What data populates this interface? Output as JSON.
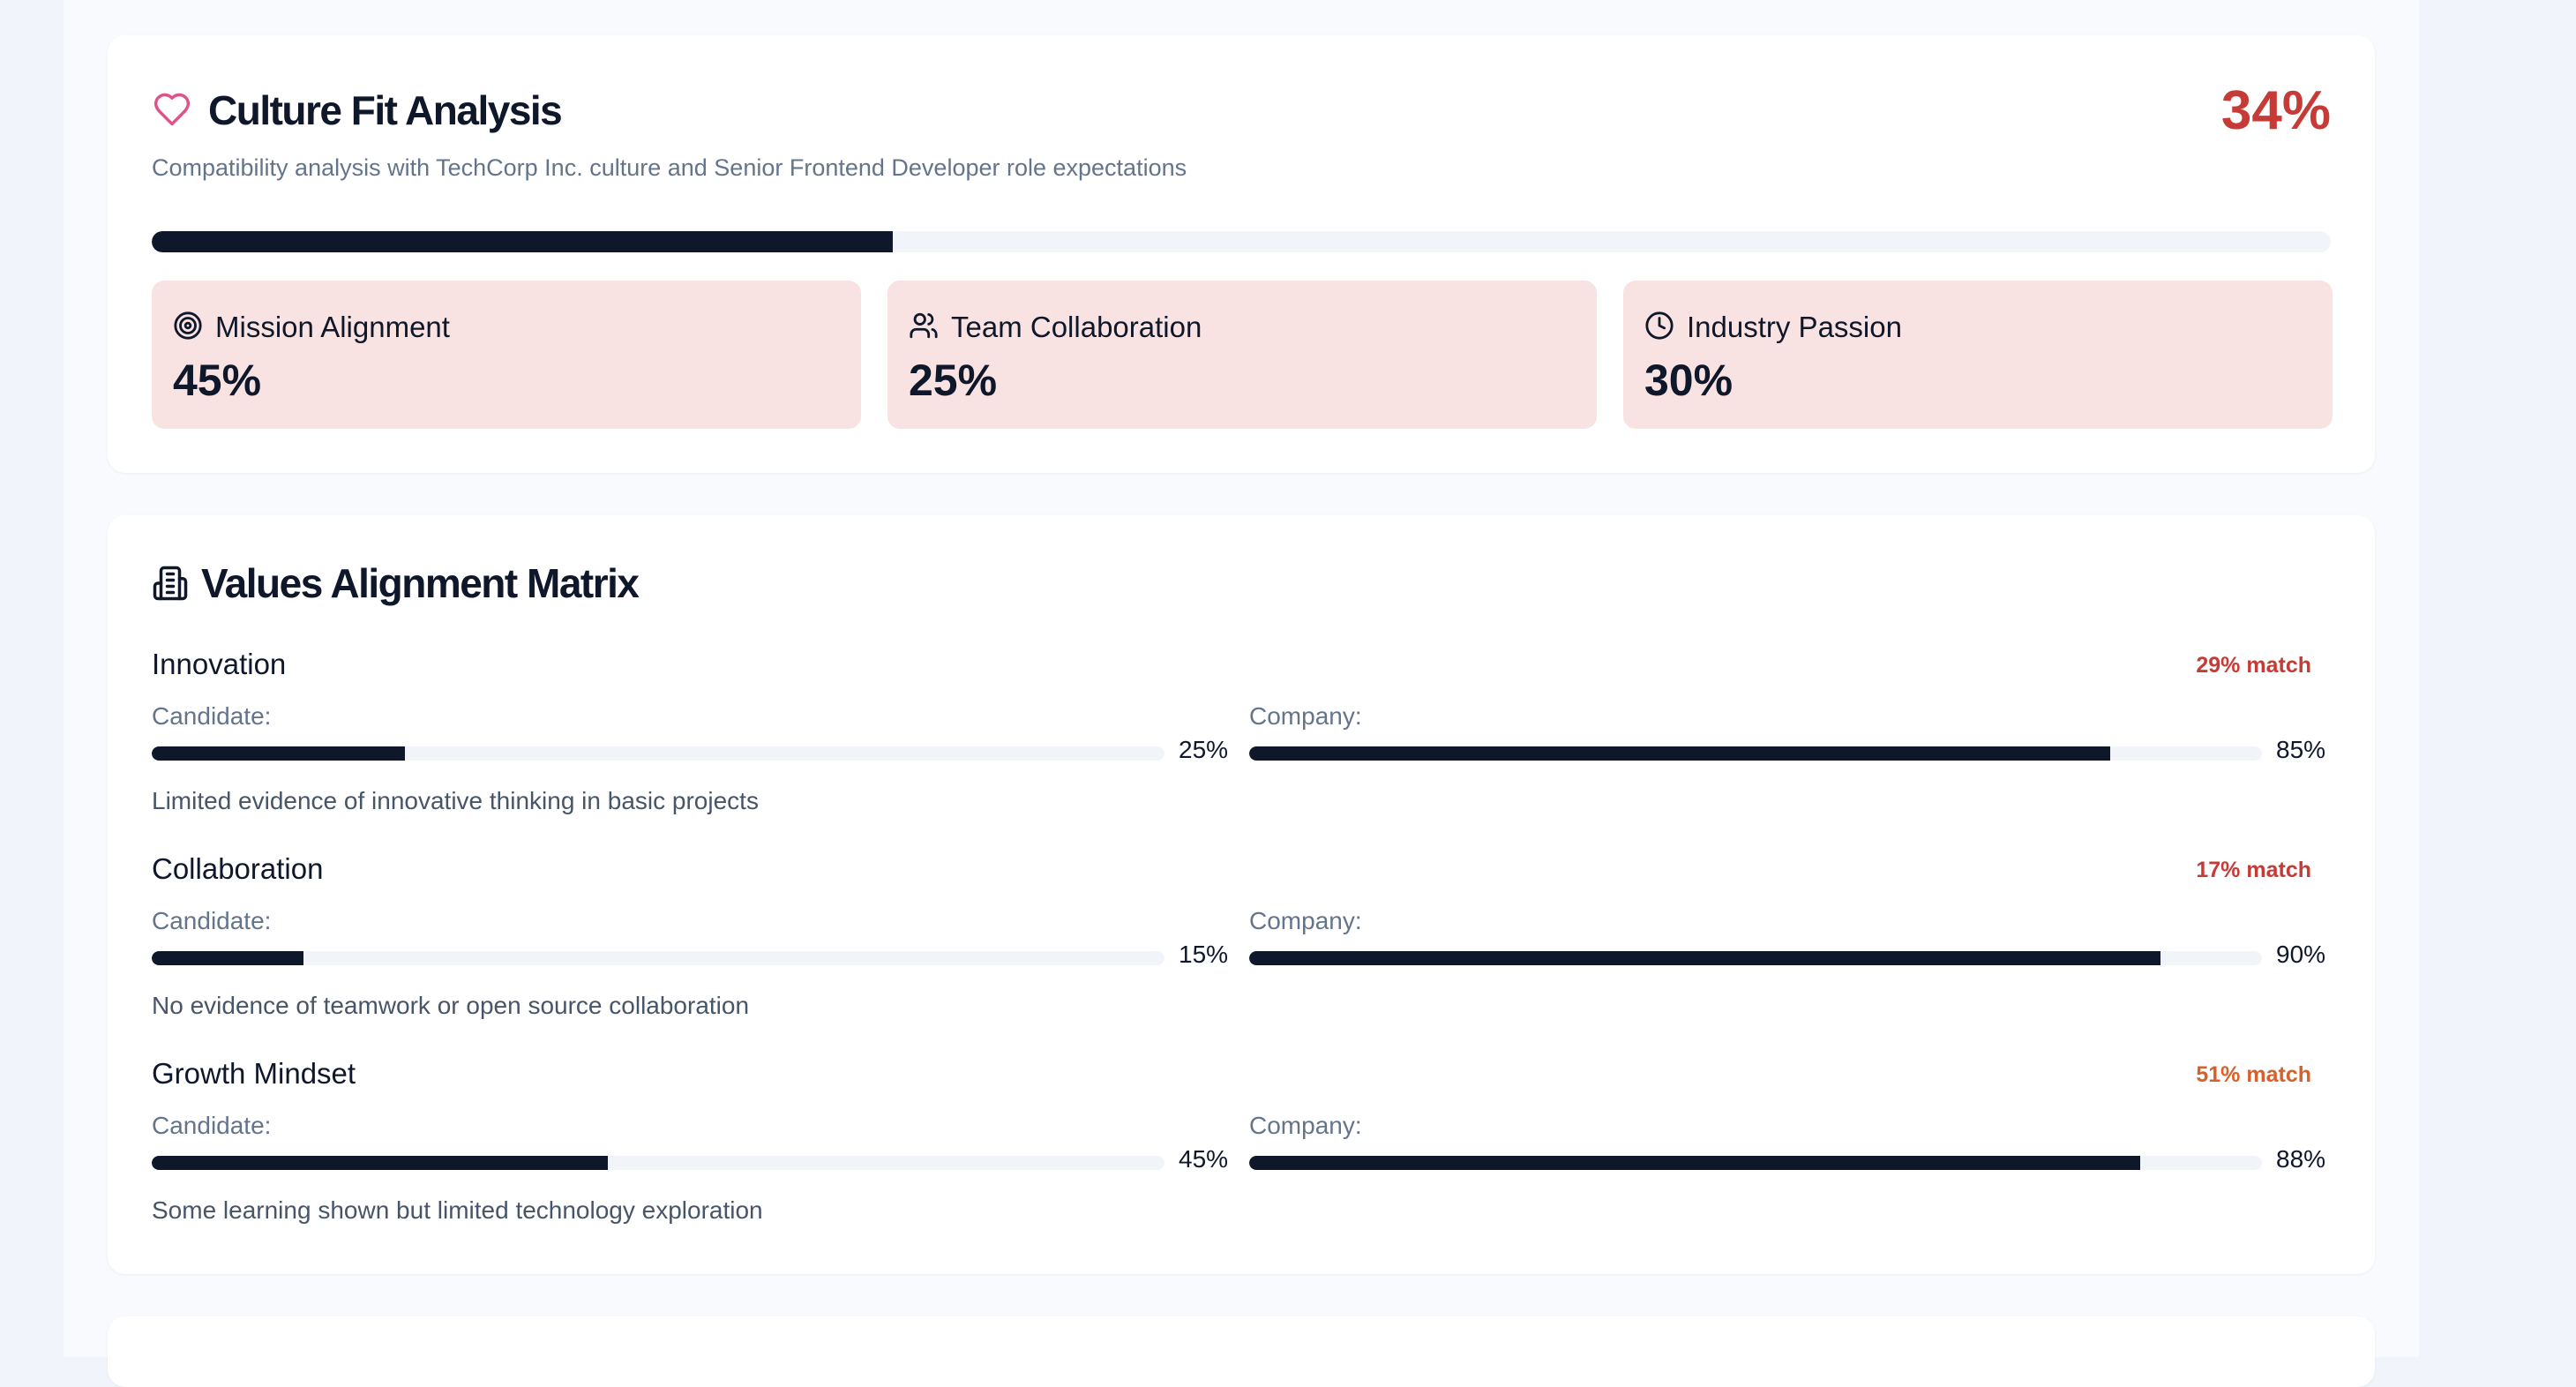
{
  "colors": {
    "accent_danger": "#c73b36",
    "accent_warning": "#d7612b",
    "bar_fill": "#0f172a",
    "bar_track": "#f1f5f9",
    "metric_bg": "#f9e3e2",
    "heart_icon": "#e0528c"
  },
  "culture_fit": {
    "title": "Culture Fit Analysis",
    "title_icon": "heart-icon",
    "score": "34%",
    "score_fraction": 0.34,
    "subtitle": "Compatibility analysis with TechCorp Inc. culture and Senior Frontend Developer role expectations",
    "metrics": [
      {
        "icon": "target-icon",
        "label": "Mission Alignment",
        "value": "45%"
      },
      {
        "icon": "users-icon",
        "label": "Team Collaboration",
        "value": "25%"
      },
      {
        "icon": "clock-icon",
        "label": "Industry Passion",
        "value": "30%"
      }
    ]
  },
  "values_matrix": {
    "title": "Values Alignment Matrix",
    "title_icon": "building-icon",
    "candidate_label": "Candidate:",
    "company_label": "Company:",
    "items": [
      {
        "name": "Innovation",
        "match": "29% match",
        "match_level": "danger",
        "candidate": 25,
        "candidate_text": "25%",
        "company": 85,
        "company_text": "85%",
        "note": "Limited evidence of innovative thinking in basic projects"
      },
      {
        "name": "Collaboration",
        "match": "17% match",
        "match_level": "danger",
        "candidate": 15,
        "candidate_text": "15%",
        "company": 90,
        "company_text": "90%",
        "note": "No evidence of teamwork or open source collaboration"
      },
      {
        "name": "Growth Mindset",
        "match": "51% match",
        "match_level": "warning",
        "candidate": 45,
        "candidate_text": "45%",
        "company": 88,
        "company_text": "88%",
        "note": "Some learning shown but limited technology exploration"
      }
    ]
  }
}
